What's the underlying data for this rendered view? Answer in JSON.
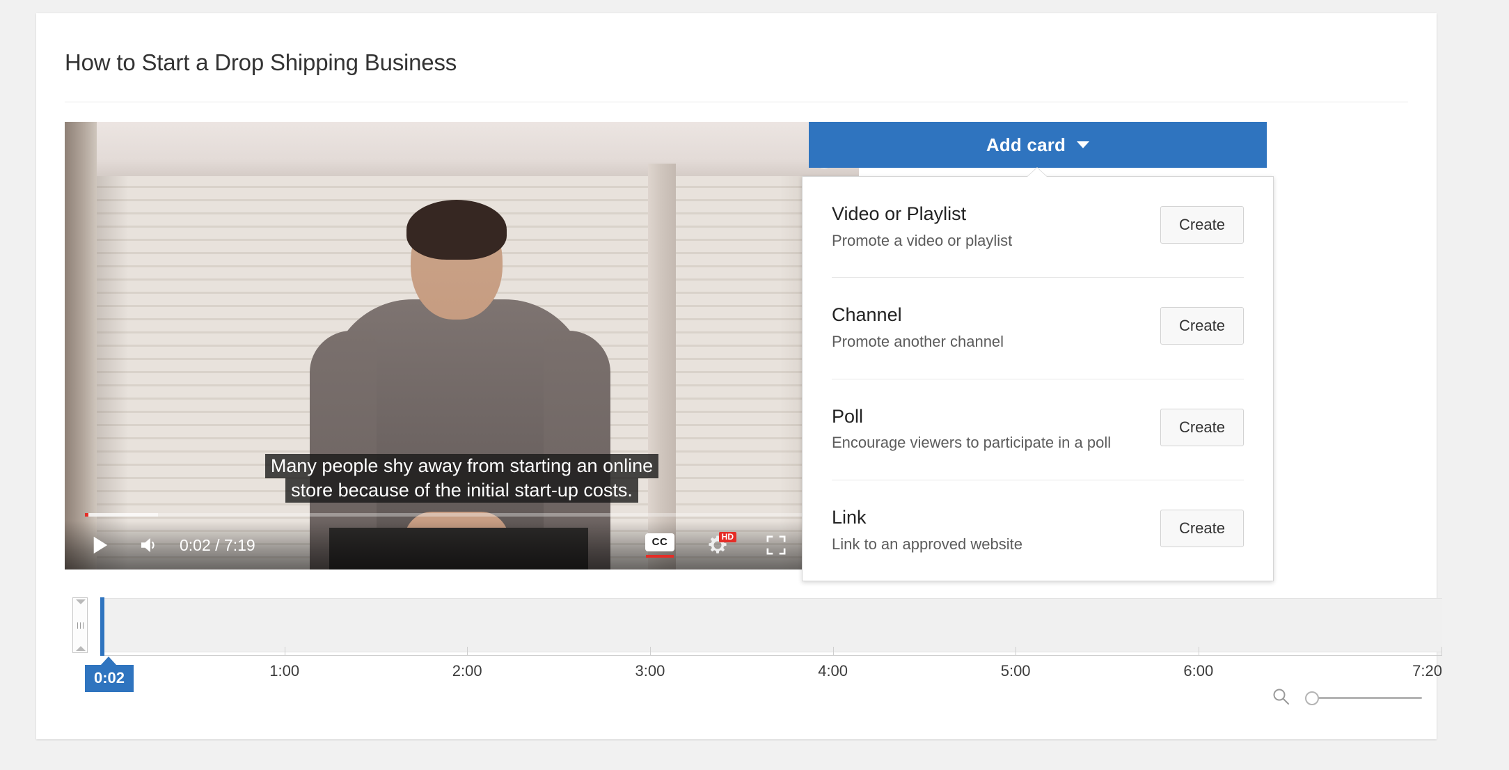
{
  "page": {
    "background_color": "#f1f1f1",
    "accent_color": "#2f74bf"
  },
  "header": {
    "video_title": "How to Start a Drop Shipping Business"
  },
  "player": {
    "info_icon": "info-icon",
    "watermark_icon": "shopify-bag-icon",
    "caption_line_1": "Many people shy away from starting an online",
    "caption_line_2": "store because of the initial start-up costs.",
    "time_display": "0:02 / 7:19",
    "current_time": "0:02",
    "duration": "7:19",
    "play_icon": "play-icon",
    "volume_icon": "volume-icon",
    "cc_label": "CC",
    "quality_badge": "HD",
    "settings_icon": "gear-icon",
    "fullscreen_icon": "fullscreen-icon",
    "progress_percent": 0.5,
    "buffer_percent": 9.6
  },
  "add_card": {
    "button_label": "Add card",
    "caret_icon": "chevron-down-icon",
    "menu": [
      {
        "title": "Video or Playlist",
        "description": "Promote a video or playlist",
        "action_label": "Create"
      },
      {
        "title": "Channel",
        "description": "Promote another channel",
        "action_label": "Create"
      },
      {
        "title": "Poll",
        "description": "Encourage viewers to participate in a poll",
        "action_label": "Create"
      },
      {
        "title": "Link",
        "description": "Link to an approved website",
        "action_label": "Create"
      }
    ]
  },
  "timeline": {
    "playhead_time": "0:02",
    "ticks": [
      {
        "label": "1:00",
        "position_percent": 13.64
      },
      {
        "label": "2:00",
        "position_percent": 27.27
      },
      {
        "label": "3:00",
        "position_percent": 40.91
      },
      {
        "label": "4:00",
        "position_percent": 54.55
      },
      {
        "label": "5:00",
        "position_percent": 68.18
      },
      {
        "label": "6:00",
        "position_percent": 81.82
      }
    ],
    "end_label": "7:20",
    "zoom_icon": "magnifier-icon",
    "zoom_value": 0
  }
}
